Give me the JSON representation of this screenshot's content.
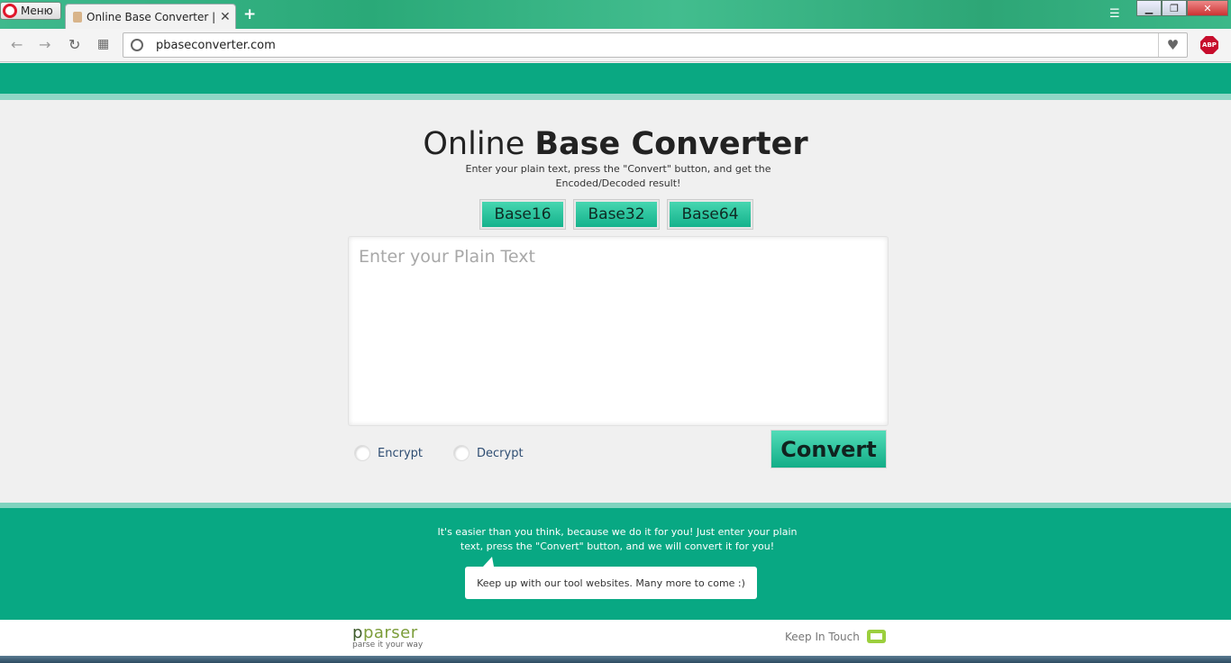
{
  "browser": {
    "menu_label": "Меню",
    "tab_title": "Online Base Converter | Co",
    "tab_close": "✕",
    "new_tab": "+",
    "url": "pbaseconverter.com",
    "abp_label": "ABP"
  },
  "page": {
    "title_light": "Online ",
    "title_bold": "Base Converter",
    "subtitle": "Enter your plain text, press the \"Convert\" button, and get the Encoded/Decoded result!",
    "tabs": [
      {
        "label": "Base16"
      },
      {
        "label": "Base32"
      },
      {
        "label": "Base64"
      }
    ],
    "input": {
      "placeholder": "Enter your Plain Text",
      "value": ""
    },
    "options": [
      {
        "label": "Encrypt"
      },
      {
        "label": "Decrypt"
      }
    ],
    "convert_label": "Convert",
    "footer_text": "It's easier than you think, because we do it for you! Just enter your plain text, press the \"Convert\" button, and we will convert it for you!",
    "bubble_text": "Keep up with our tool websites. Many more to come :)",
    "brand_p": "p",
    "brand_rest": "parser",
    "brand_tagline": "parse it your way",
    "keep_in_touch": "Keep In Touch"
  },
  "colors": {
    "brand_green": "#0aa882",
    "button_green": "#20c09a",
    "logo_green": "#7c9d3a"
  }
}
